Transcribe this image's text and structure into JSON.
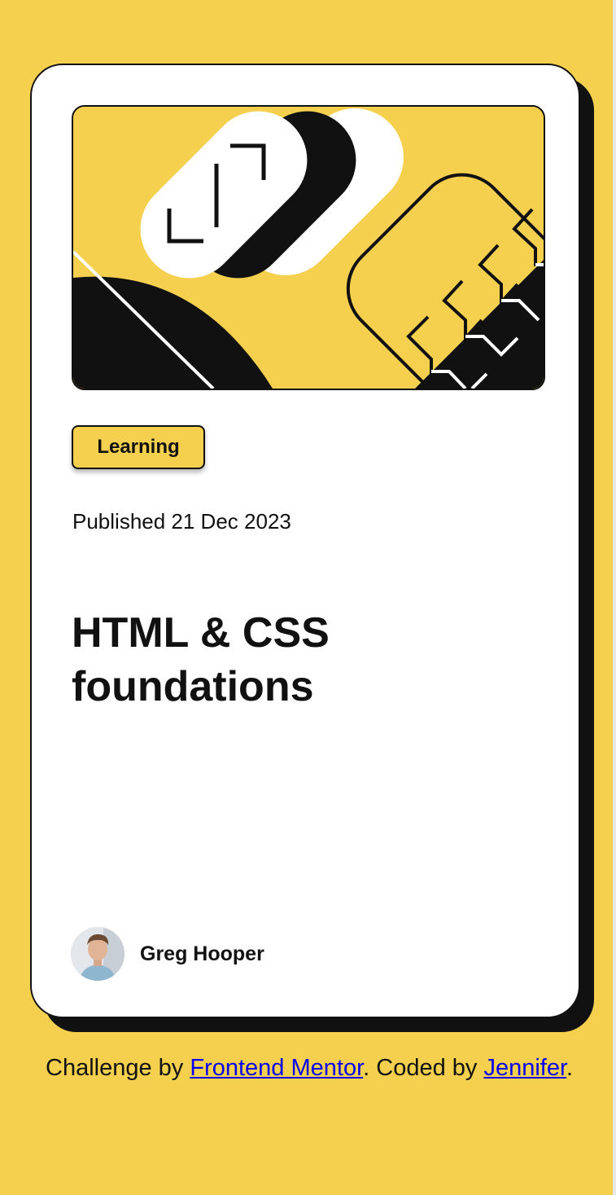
{
  "card": {
    "tag": "Learning",
    "published": "Published 21 Dec 2023",
    "title": "HTML & CSS foundations",
    "author": {
      "name": "Greg Hooper"
    },
    "hero_image": {
      "icon": "illustration-article"
    }
  },
  "attribution": {
    "prefix": "Challenge by ",
    "link1_text": "Frontend Mentor",
    "middle": ". Coded by ",
    "link2_text": "Jennifer",
    "suffix": "."
  },
  "colors": {
    "background": "#f4d04e",
    "ink": "#111111",
    "card": "#ffffff",
    "link": "#0000ee"
  }
}
